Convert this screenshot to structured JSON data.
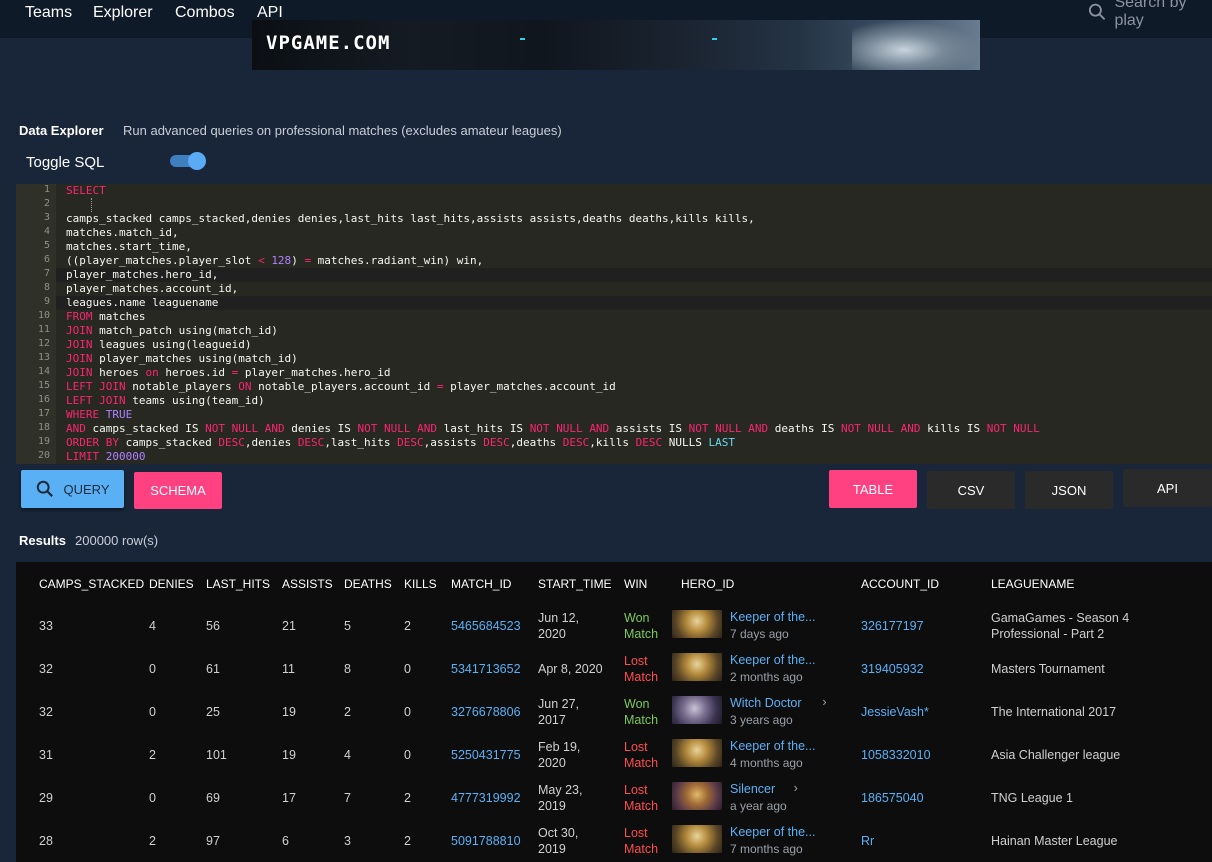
{
  "nav": {
    "items": [
      "Teams",
      "Explorer",
      "Combos",
      "API"
    ],
    "search_placeholder": "Search by play"
  },
  "banner": {
    "logo": "VPGAME.COM"
  },
  "explorer": {
    "title": "Data Explorer",
    "subtitle": "Run advanced queries on professional matches (excludes amateur leagues)",
    "toggle_label": "Toggle SQL",
    "toggle_on": true
  },
  "sql_lines": [
    "SELECT",
    "",
    "camps_stacked camps_stacked,denies denies,last_hits last_hits,assists assists,deaths deaths,kills kills,",
    "matches.match_id,",
    "matches.start_time,",
    "((player_matches.player_slot < 128) = matches.radiant_win) win,",
    "player_matches.hero_id,",
    "player_matches.account_id,",
    "leagues.name leaguename",
    "FROM matches",
    "JOIN match_patch using(match_id)",
    "JOIN leagues using(leagueid)",
    "JOIN player_matches using(match_id)",
    "JOIN heroes on heroes.id = player_matches.hero_id",
    "LEFT JOIN notable_players ON notable_players.account_id = player_matches.account_id",
    "LEFT JOIN teams using(team_id)",
    "WHERE TRUE",
    "AND camps_stacked IS NOT NULL AND denies IS NOT NULL AND last_hits IS NOT NULL AND assists IS NOT NULL AND deaths IS NOT NULL AND kills IS NOT NULL",
    "ORDER BY camps_stacked DESC,denies DESC,last_hits DESC,assists DESC,deaths DESC,kills DESC NULLS LAST",
    "LIMIT 200000"
  ],
  "buttons": {
    "query": "QUERY",
    "schema": "SCHEMA",
    "table": "TABLE",
    "csv": "CSV",
    "json": "JSON",
    "api": "API"
  },
  "results": {
    "title": "Results",
    "count": "200000 row(s)",
    "columns": [
      "CAMPS_STACKED",
      "DENIES",
      "LAST_HITS",
      "ASSISTS",
      "DEATHS",
      "KILLS",
      "MATCH_ID",
      "START_TIME",
      "WIN",
      "HERO_ID",
      "ACCOUNT_ID",
      "LEAGUENAME"
    ],
    "rows": [
      {
        "camps_stacked": "33",
        "denies": "4",
        "last_hits": "56",
        "assists": "21",
        "deaths": "5",
        "kills": "2",
        "match_id": "5465684523",
        "start_date": "Jun 12,",
        "start_year": "2020",
        "win_1": "Won",
        "win_2": "Match",
        "won": true,
        "hero": "Keeper of the...",
        "hero_ago": "7 days ago",
        "hero_icon": "keeper-of-the-light",
        "account_id": "326177197",
        "league_1": "GamaGames - Season 4",
        "league_2": "Professional - Part 2"
      },
      {
        "camps_stacked": "32",
        "denies": "0",
        "last_hits": "61",
        "assists": "11",
        "deaths": "8",
        "kills": "0",
        "match_id": "5341713652",
        "start_date": "Apr 8, 2020",
        "start_year": "",
        "win_1": "Lost",
        "win_2": "Match",
        "won": false,
        "hero": "Keeper of the...",
        "hero_ago": "2 months ago",
        "hero_icon": "keeper-of-the-light",
        "account_id": "319405932",
        "league_1": "Masters Tournament",
        "league_2": ""
      },
      {
        "camps_stacked": "32",
        "denies": "0",
        "last_hits": "25",
        "assists": "19",
        "deaths": "2",
        "kills": "0",
        "match_id": "3276678806",
        "start_date": "Jun 27,",
        "start_year": "2017",
        "win_1": "Won",
        "win_2": "Match",
        "won": true,
        "hero": "Witch Doctor",
        "hero_ago": "3 years ago",
        "hero_icon": "witch-doctor",
        "account_id": "JessieVash*",
        "league_1": "The International 2017",
        "league_2": ""
      },
      {
        "camps_stacked": "31",
        "denies": "2",
        "last_hits": "101",
        "assists": "19",
        "deaths": "4",
        "kills": "0",
        "match_id": "5250431775",
        "start_date": "Feb 19,",
        "start_year": "2020",
        "win_1": "Lost",
        "win_2": "Match",
        "won": false,
        "hero": "Keeper of the...",
        "hero_ago": "4 months ago",
        "hero_icon": "keeper-of-the-light",
        "account_id": "1058332010",
        "league_1": "Asia Challenger league",
        "league_2": ""
      },
      {
        "camps_stacked": "29",
        "denies": "0",
        "last_hits": "69",
        "assists": "17",
        "deaths": "7",
        "kills": "2",
        "match_id": "4777319992",
        "start_date": "May 23,",
        "start_year": "2019",
        "win_1": "Lost",
        "win_2": "Match",
        "won": false,
        "hero": "Silencer",
        "hero_ago": "a year ago",
        "hero_icon": "silencer",
        "account_id": "186575040",
        "league_1": "TNG League 1",
        "league_2": ""
      },
      {
        "camps_stacked": "28",
        "denies": "2",
        "last_hits": "97",
        "assists": "6",
        "deaths": "3",
        "kills": "2",
        "match_id": "5091788810",
        "start_date": "Oct 30,",
        "start_year": "2019",
        "win_1": "Lost",
        "win_2": "Match",
        "won": false,
        "hero": "Keeper of the...",
        "hero_ago": "7 months ago",
        "hero_icon": "keeper-of-the-light",
        "account_id": "Rr",
        "league_1": "Hainan Master League",
        "league_2": ""
      }
    ]
  }
}
